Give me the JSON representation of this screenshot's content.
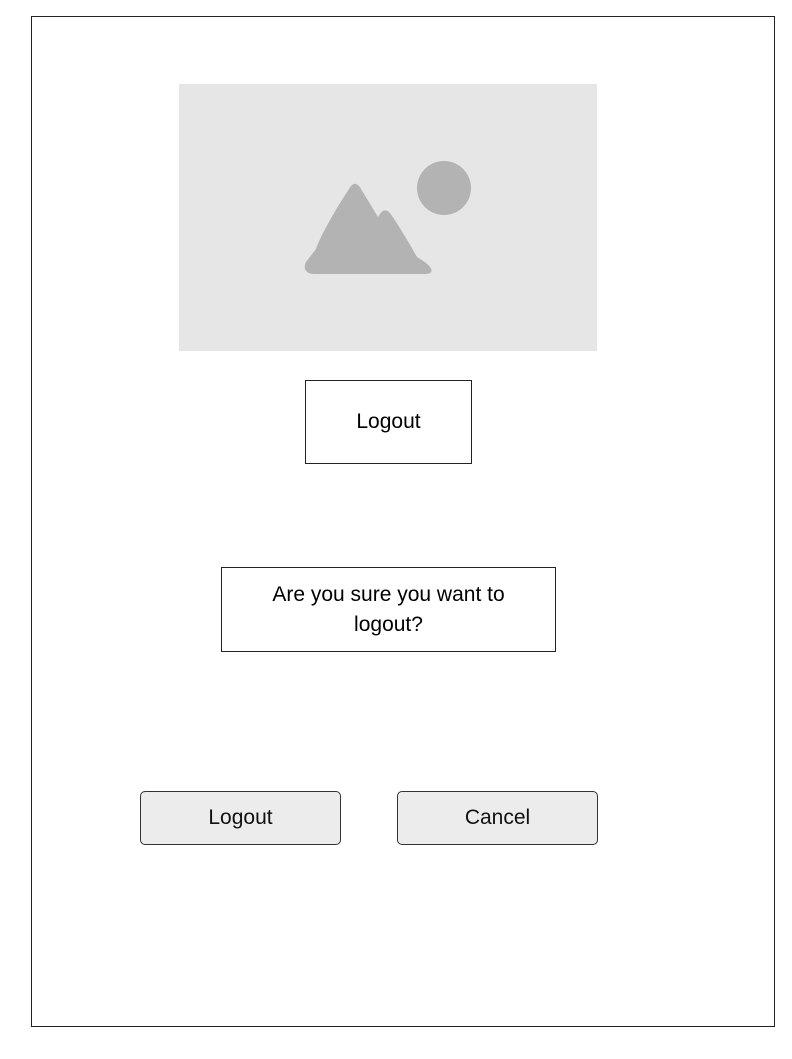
{
  "dialog": {
    "image": {
      "icon": "image-placeholder-icon"
    },
    "title": "Logout",
    "message": "Are you sure you want to logout?",
    "buttons": {
      "confirm_label": "Logout",
      "cancel_label": "Cancel"
    }
  },
  "colors": {
    "border": "#222222",
    "placeholder_bg": "#e6e6e6",
    "placeholder_icon": "#b3b3b3",
    "button_bg": "#ececec"
  }
}
